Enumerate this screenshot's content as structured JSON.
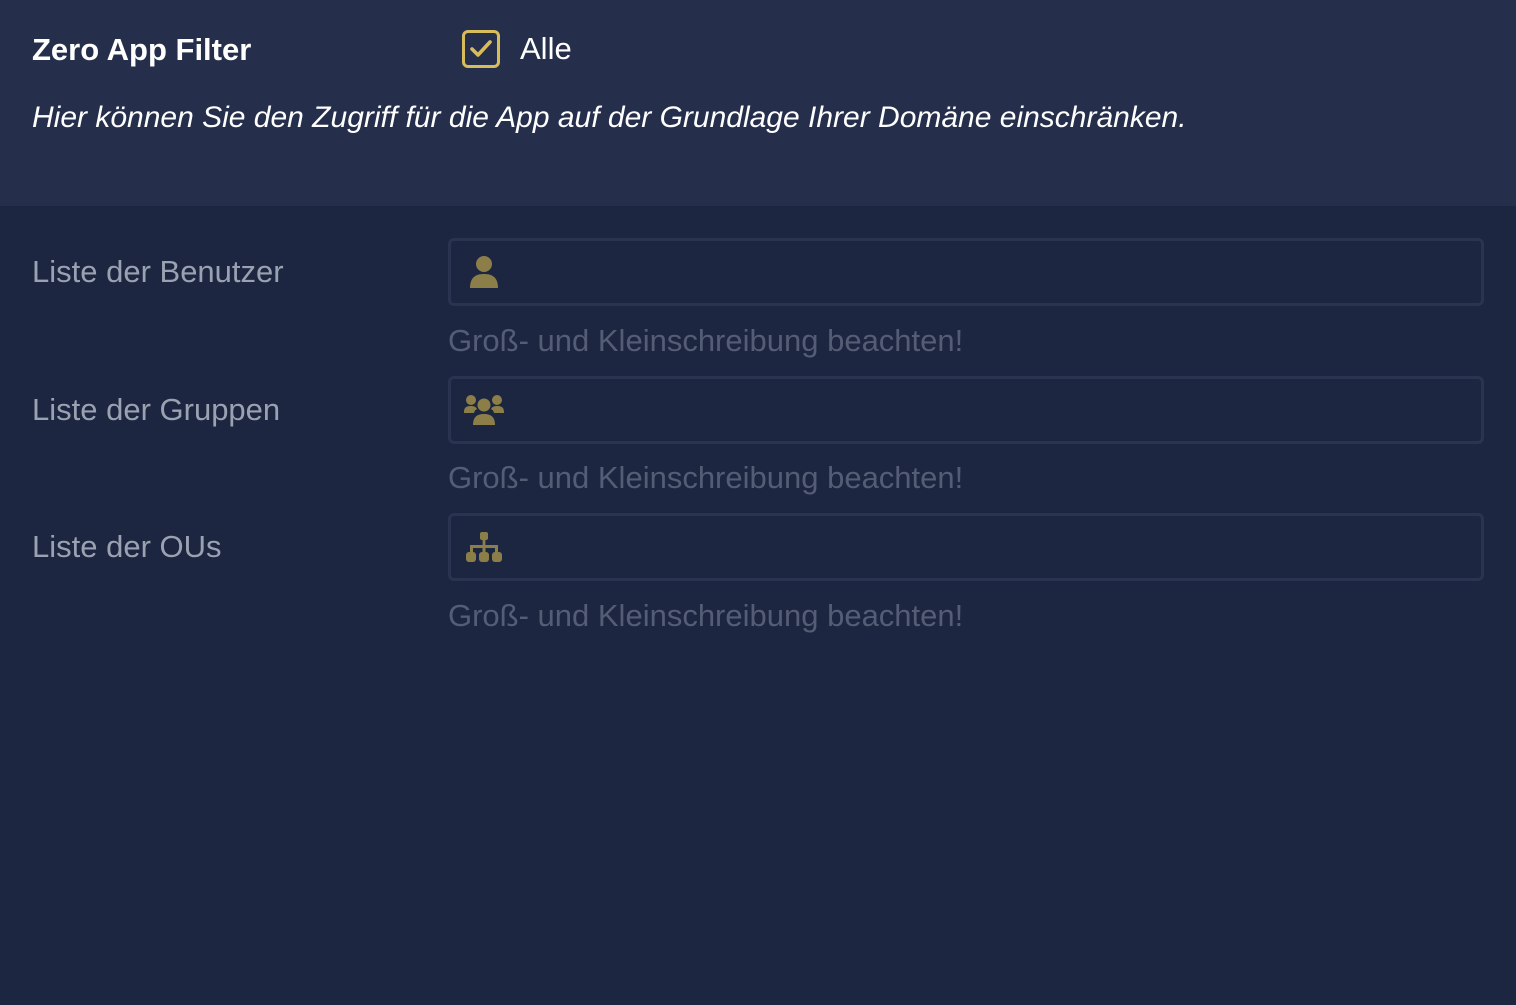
{
  "header": {
    "title": "Zero App Filter",
    "checkbox": {
      "label": "Alle",
      "checked": true
    },
    "description": "Hier können Sie den Zugriff für die App auf der Grundlage Ihrer Domäne einschränken."
  },
  "rows": [
    {
      "label": "Liste der Benutzer",
      "value": "",
      "placeholder": "",
      "icon": "user-icon",
      "hint": "Groß- und Kleinschreibung beachten!"
    },
    {
      "label": "Liste der Gruppen",
      "value": "",
      "placeholder": "",
      "icon": "users-icon",
      "hint": "Groß- und Kleinschreibung beachten!"
    },
    {
      "label": "Liste der OUs",
      "value": "",
      "placeholder": "",
      "icon": "sitemap-icon",
      "hint": "Groß- und Kleinschreibung beachten!"
    }
  ],
  "colors": {
    "accent": "#d9bc5a",
    "icon": "#8c7e49",
    "header_bg": "#252f4c",
    "body_bg": "#1c2640",
    "label": "#9aa1b1",
    "hint": "#545d74"
  }
}
